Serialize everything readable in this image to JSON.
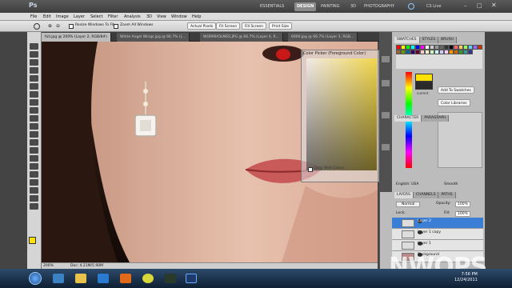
{
  "app": {
    "logo": "Ps",
    "workspaces": [
      "ESSENTIALS",
      "DESIGN",
      "PAINTING",
      "3D",
      "PHOTOGRAPHY"
    ],
    "active_workspace": "DESIGN",
    "cs_live": "CS Live"
  },
  "menu": [
    "File",
    "Edit",
    "Image",
    "Layer",
    "Select",
    "Filter",
    "Analysis",
    "3D",
    "View",
    "Window",
    "Help"
  ],
  "options": {
    "resize_label": "Resize Windows To Fit",
    "zoom_all_label": "Zoom All Windows",
    "actual_pixels": "Actual Pixels",
    "fit_screen": "Fit Screen",
    "fill_screen": "Fill Screen",
    "print_size": "Print Size"
  },
  "doc_tabs": [
    {
      "label": "foli.jpg @ 200% (Layer 2, RGB/8#)",
      "active": true
    },
    {
      "label": "White Angel Wings.jpg @ 66.7% (L...",
      "active": false
    },
    {
      "label": "WORMHOLMES.JPG @ 66.7% (Layer 4, R...",
      "active": false
    },
    {
      "label": "6000.jpg @ 66.7% (Layer 3, RGB...",
      "active": false
    }
  ],
  "status": {
    "zoom": "200%",
    "doc": "Doc: 4.21M/5.90M"
  },
  "color_picker": {
    "title": "Color Picker (Foreground Color)",
    "only_web": "Only Web Colors",
    "add_swatches": "Add To Swatches",
    "color_libraries": "Color Libraries",
    "current": "current"
  },
  "panels": {
    "swatches_tabs": [
      "SWATCHES",
      "STYLES",
      "BRUSH"
    ],
    "char_tabs": [
      "CHARACTER",
      "PARAGRAPH"
    ],
    "language": "English: USA",
    "anti_alias": "Smooth",
    "layers_tabs": [
      "LAYERS",
      "CHANNELS",
      "PATHS"
    ],
    "blend_mode": "Normal",
    "opacity_label": "Opacity:",
    "opacity": "100%",
    "lock_label": "Lock:",
    "fill_label": "Fill:",
    "fill": "100%",
    "layers": [
      {
        "name": "Layer 2",
        "active": true
      },
      {
        "name": "Layer 1 copy",
        "active": false
      },
      {
        "name": "Layer 1",
        "active": false
      },
      {
        "name": "Background",
        "active": false
      }
    ]
  },
  "taskbar": {
    "time": "7:56 PM",
    "date": "12/24/2011"
  },
  "watermark": "NWOPS",
  "colors": {
    "accent": "#3a7fd5",
    "yellow": "#ffe100",
    "canvas_bg": "#1a0f0c"
  }
}
